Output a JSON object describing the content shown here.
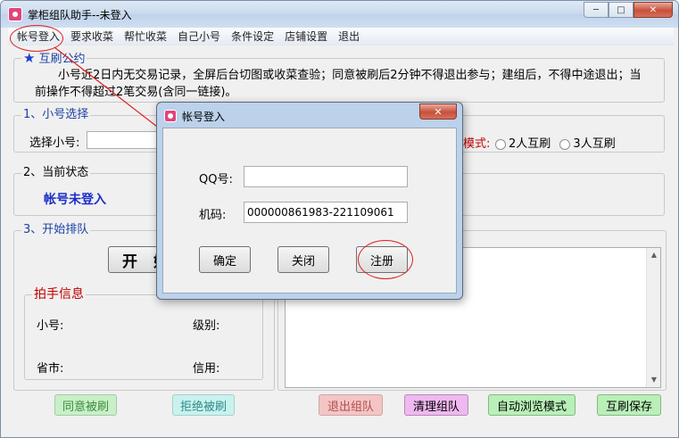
{
  "window": {
    "title": "掌柜组队助手--未登入",
    "min_label": "─",
    "max_label": "□",
    "close_label": "✕"
  },
  "menu": [
    "帐号登入",
    "要求收菜",
    "帮忙收菜",
    "自己小号",
    "条件设定",
    "店铺设置",
    "退出"
  ],
  "notice": {
    "title": "互刷公约",
    "text": "小号近2日内无交易记录，全屏后台切图或收菜查验；同意被刷后2分钟不得退出参与；建组后，不得中途退出；当前操作不得超过2笔交易(含同一链接)。"
  },
  "section1": {
    "title": "1、小号选择",
    "select_label": "选择小号:",
    "mode_label": "模式:",
    "radio1": "2人互刷",
    "radio2": "3人互刷"
  },
  "section2": {
    "title": "2、当前状态",
    "status": "帐号未登入"
  },
  "section3": {
    "title": "3、开始排队",
    "start_label": "开 始"
  },
  "partner": {
    "title": "拍手信息",
    "account_label": "小号:",
    "level_label": "级别:",
    "province_label": "省市:",
    "credit_label": "信用:"
  },
  "buttons": {
    "agree": "同意被刷",
    "reject": "拒绝被刷",
    "quit_team": "退出组队",
    "clear_team": "清理组队",
    "auto_browse": "自动浏览模式",
    "save": "互刷保存"
  },
  "dialog": {
    "title": "帐号登入",
    "qq_label": "QQ号:",
    "qq_value": "",
    "machine_label": "机码:",
    "machine_value": "000000861983-221109061",
    "ok": "确定",
    "close": "关闭",
    "register": "注册",
    "close_x": "✕"
  }
}
